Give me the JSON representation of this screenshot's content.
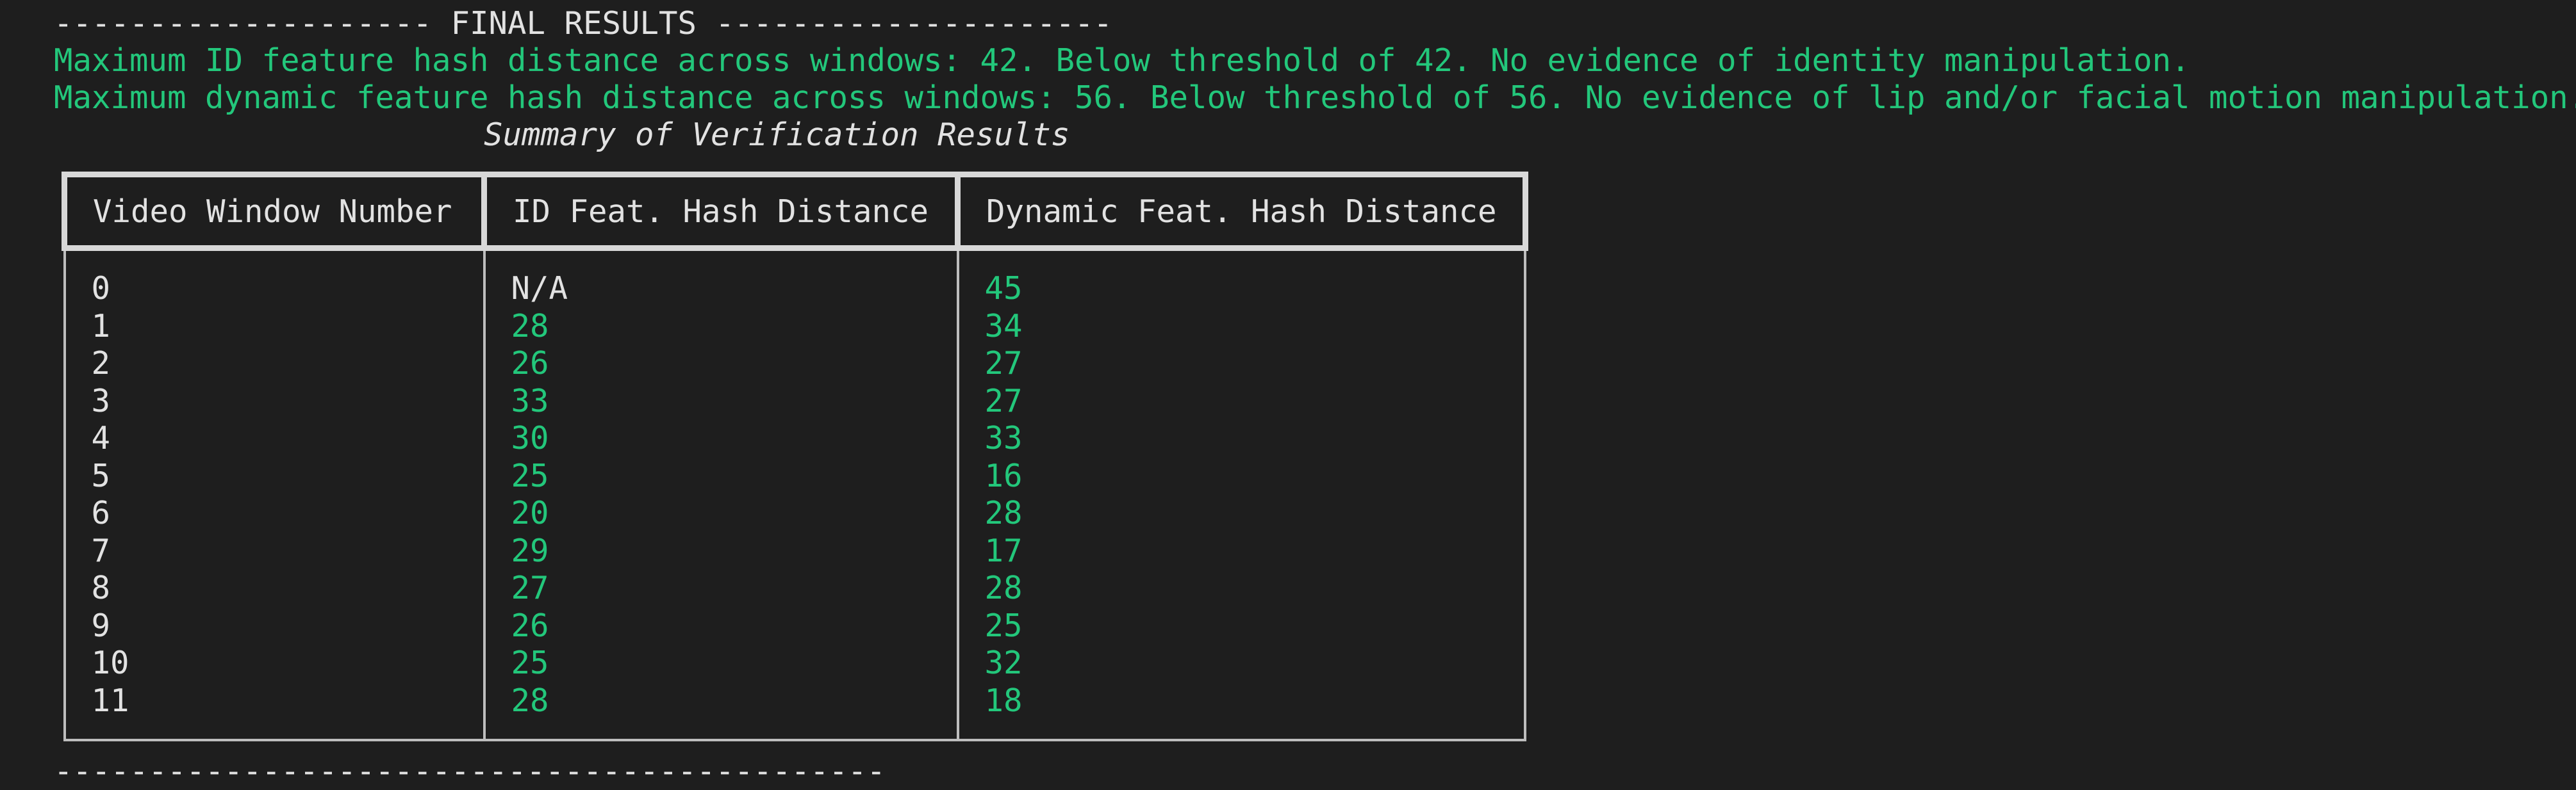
{
  "terminal": {
    "header_line": "-------------------- FINAL RESULTS ---------------------",
    "message_id": "Maximum ID feature hash distance across windows: 42. Below threshold of 42. No evidence of identity manipulation.",
    "message_dynamic": "Maximum dynamic feature hash distance across windows: 56. Below threshold of 56. No evidence of lip and/or facial motion manipulation.",
    "table_caption": "Summary of Verification Results",
    "footer_line": "--------------------------------------------",
    "colors": {
      "background": "#1e1e1e",
      "text": "#e2e2e2",
      "accent_green": "#23c77b"
    }
  },
  "table": {
    "headers": [
      "Video Window Number",
      "ID Feat. Hash Distance",
      "Dynamic Feat. Hash Distance"
    ],
    "rows": [
      {
        "window": "0",
        "id_dist": "N/A",
        "dyn_dist": "45"
      },
      {
        "window": "1",
        "id_dist": "28",
        "dyn_dist": "34"
      },
      {
        "window": "2",
        "id_dist": "26",
        "dyn_dist": "27"
      },
      {
        "window": "3",
        "id_dist": "33",
        "dyn_dist": "27"
      },
      {
        "window": "4",
        "id_dist": "30",
        "dyn_dist": "33"
      },
      {
        "window": "5",
        "id_dist": "25",
        "dyn_dist": "16"
      },
      {
        "window": "6",
        "id_dist": "20",
        "dyn_dist": "28"
      },
      {
        "window": "7",
        "id_dist": "29",
        "dyn_dist": "17"
      },
      {
        "window": "8",
        "id_dist": "27",
        "dyn_dist": "28"
      },
      {
        "window": "9",
        "id_dist": "26",
        "dyn_dist": "25"
      },
      {
        "window": "10",
        "id_dist": "25",
        "dyn_dist": "32"
      },
      {
        "window": "11",
        "id_dist": "28",
        "dyn_dist": "18"
      }
    ]
  }
}
